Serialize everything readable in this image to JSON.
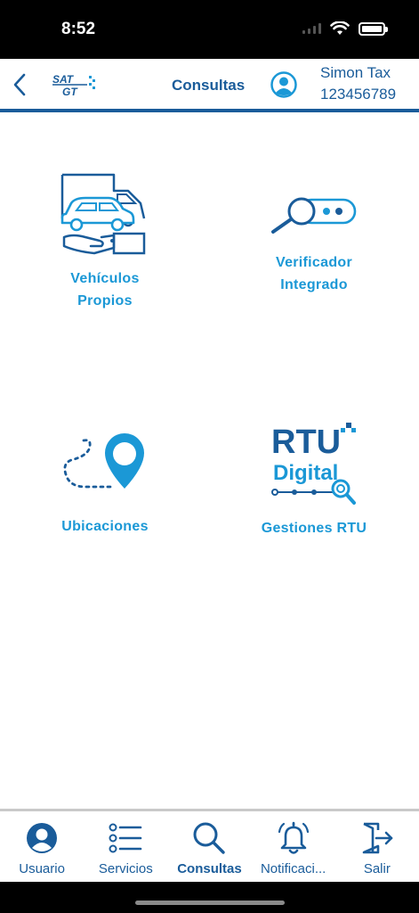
{
  "status_bar": {
    "time": "8:52"
  },
  "header": {
    "title": "Consultas",
    "logo_top": "SAT",
    "logo_bottom": "GT",
    "user_name": "Simon Tax",
    "user_nit": "123456789"
  },
  "tiles": [
    {
      "label_line1": "Vehículos",
      "label_line2": "Propios",
      "icon": "car-hand-icon"
    },
    {
      "label_line1": "Verificador",
      "label_line2": "Integrado",
      "icon": "magnifier-toggle-icon"
    },
    {
      "label_line1": "Ubicaciones",
      "icon": "map-pin-route-icon"
    },
    {
      "label_line1": "Gestiones RTU",
      "icon": "rtu-digital-logo",
      "logo_word1": "RTU",
      "logo_word2": "Digital"
    }
  ],
  "tabs": [
    {
      "label": "Usuario",
      "icon": "user-circle-icon"
    },
    {
      "label": "Servicios",
      "icon": "list-icon"
    },
    {
      "label": "Consultas",
      "icon": "search-icon",
      "active": true
    },
    {
      "label": "Notificaci...",
      "icon": "bell-icon"
    },
    {
      "label": "Salir",
      "icon": "exit-door-icon"
    }
  ],
  "colors": {
    "primary": "#1a5c9a",
    "accent": "#1b98d6"
  }
}
